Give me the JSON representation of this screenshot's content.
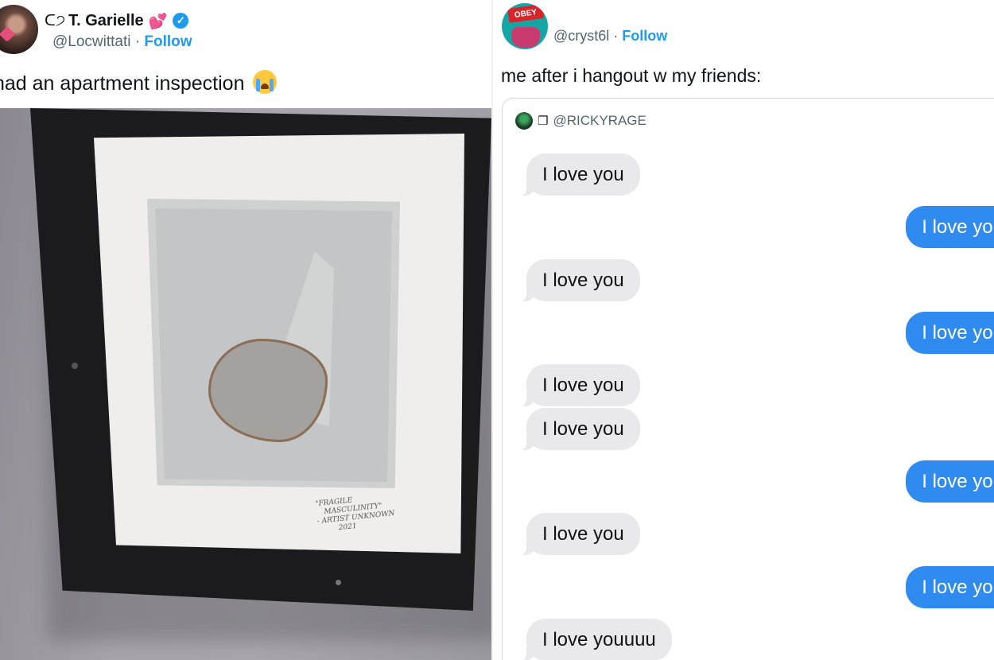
{
  "left_tweet": {
    "name_prefix": "ᑕ੭",
    "display_name": "T. Garielle",
    "heart": "💕",
    "verified": "✓",
    "handle": "@Locwittati",
    "separator": " · ",
    "follow": "Follow",
    "text": "had an apartment inspection",
    "emoji_name": "loudly-crying-face-icon",
    "photo_caption": [
      "\"FRAGILE",
      "MASCULINITY\"",
      "- ARTIST UNKNOWN",
      "2021"
    ]
  },
  "right_tweet": {
    "avatar_cap_text": "OBEY",
    "handle": "@cryst6l",
    "separator": " · ",
    "follow": "Follow",
    "text": "me after i hangout w my friends:",
    "quote": {
      "handle": "@RICKYRAGE",
      "messages": [
        {
          "side": "received",
          "text": "I love you"
        },
        {
          "side": "sent",
          "text": "I love you"
        },
        {
          "side": "received",
          "text": "I love you"
        },
        {
          "side": "sent",
          "text": "I love you"
        },
        {
          "side": "received",
          "text": "I love you"
        },
        {
          "side": "received",
          "text": "I love you"
        },
        {
          "side": "sent",
          "text": "I love you"
        },
        {
          "side": "received",
          "text": "I love you"
        },
        {
          "side": "sent",
          "text": "I love you"
        },
        {
          "side": "received",
          "text": "I love youuuu"
        }
      ]
    }
  },
  "colors": {
    "follow_blue": "#1d9bf0",
    "imessage_blue": "#2f8bf0",
    "imessage_gray": "#e9e9eb"
  }
}
